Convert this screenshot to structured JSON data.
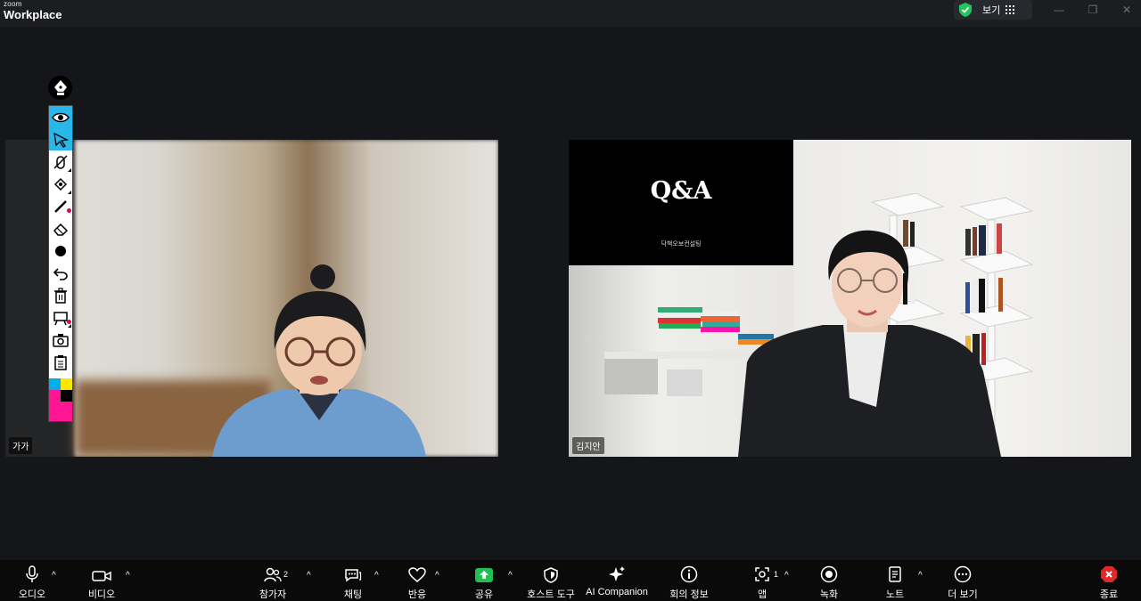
{
  "titlebar": {
    "logo_small": "zoom",
    "logo_big": "Workplace",
    "view_label": "보기",
    "minimize": "—",
    "restore": "❐",
    "close": "✕"
  },
  "participants": [
    {
      "name": "가가"
    },
    {
      "name": "김지안"
    }
  ],
  "slide": {
    "title": "Q&A",
    "subtitle": "닥책오보컨설팅"
  },
  "annotation_tools": [
    {
      "name": "spotlight",
      "icon": "eye-icon",
      "selected": true
    },
    {
      "name": "select",
      "icon": "arrow-pointer-icon",
      "selected": true
    },
    {
      "name": "mouse",
      "icon": "no-mouse-icon"
    },
    {
      "name": "stamp",
      "icon": "stamp-icon"
    },
    {
      "name": "pen",
      "icon": "pen-icon"
    },
    {
      "name": "eraser",
      "icon": "eraser-icon"
    },
    {
      "name": "color",
      "icon": "dot-icon"
    },
    {
      "name": "undo",
      "icon": "undo-icon"
    },
    {
      "name": "clear",
      "icon": "trash-icon"
    },
    {
      "name": "whiteboard",
      "icon": "easel-icon"
    },
    {
      "name": "camera",
      "icon": "camera-icon"
    },
    {
      "name": "notes",
      "icon": "clipboard-icon"
    }
  ],
  "colors": {
    "accent_blue": "#29b6e8",
    "accent_pink": "#e2005a",
    "swatch_cyan": "#00aeef",
    "swatch_yellow": "#ffe600",
    "swatch_magenta": "#ff1493",
    "share_green": "#1fbf55",
    "end_red": "#e02828",
    "shield_green": "#23c55e"
  },
  "toolbar": {
    "audio": "오디오",
    "video": "비디오",
    "participants": "참가자",
    "participants_count": "2",
    "chat": "채팅",
    "reactions": "반응",
    "share": "공유",
    "host_tools": "호스트 도구",
    "ai_companion": "AI Companion",
    "meeting_info": "회의 정보",
    "apps": "앱",
    "apps_count": "1",
    "record": "녹화",
    "notes": "노트",
    "more": "더 보기",
    "end": "종료",
    "caret": "^"
  }
}
